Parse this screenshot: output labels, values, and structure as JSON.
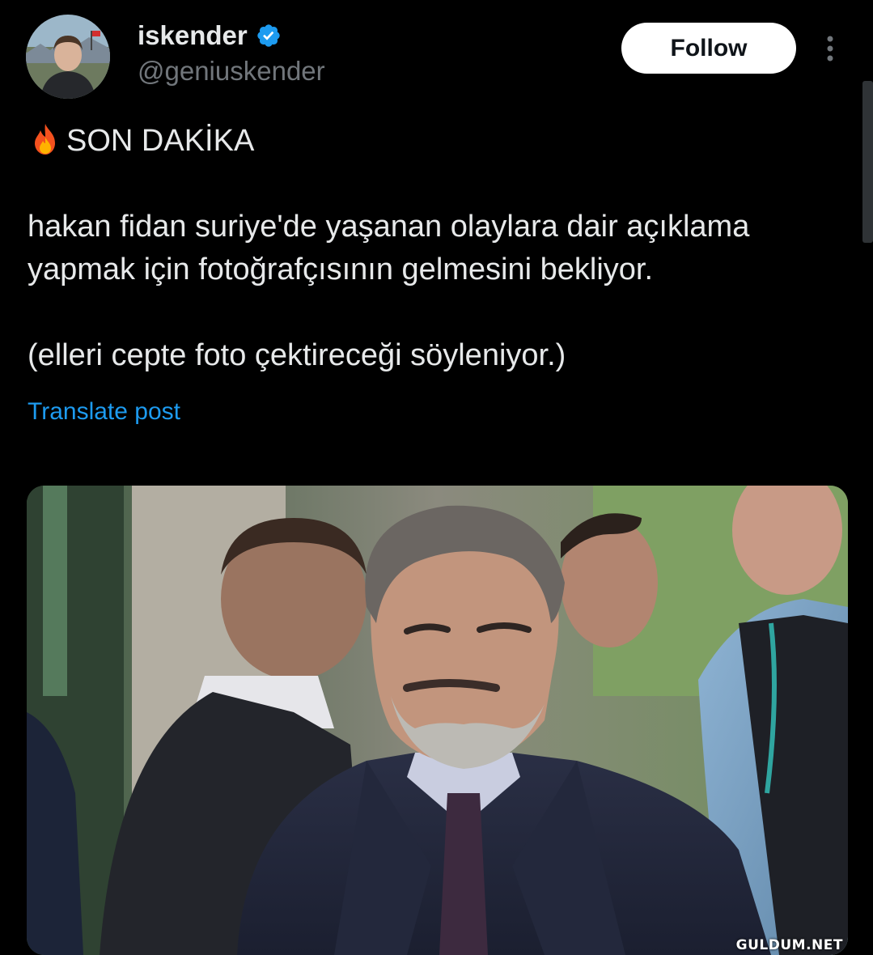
{
  "author": {
    "display_name": "iskender",
    "handle": "@geniuskender",
    "verified": true,
    "verified_color": "#1d9bf0"
  },
  "actions": {
    "follow_label": "Follow",
    "more_icon": "more-vertical-icon",
    "translate_label": "Translate post"
  },
  "tweet": {
    "headline_icon": "fire-icon",
    "headline": "SON DAKİKA",
    "body": "hakan fidan suriye'de yaşanan olaylara dair açıklama yapmak için fotoğrafçısının gelmesini bekliyor.",
    "note": "(elleri cepte foto çektireceği söyleniyor.)"
  },
  "media": {
    "watermark": "GULDUM.NET"
  },
  "colors": {
    "background": "#000000",
    "text": "#e7e9ea",
    "secondary_text": "#71767b",
    "link": "#1d9bf0",
    "follow_bg": "#ffffff"
  }
}
